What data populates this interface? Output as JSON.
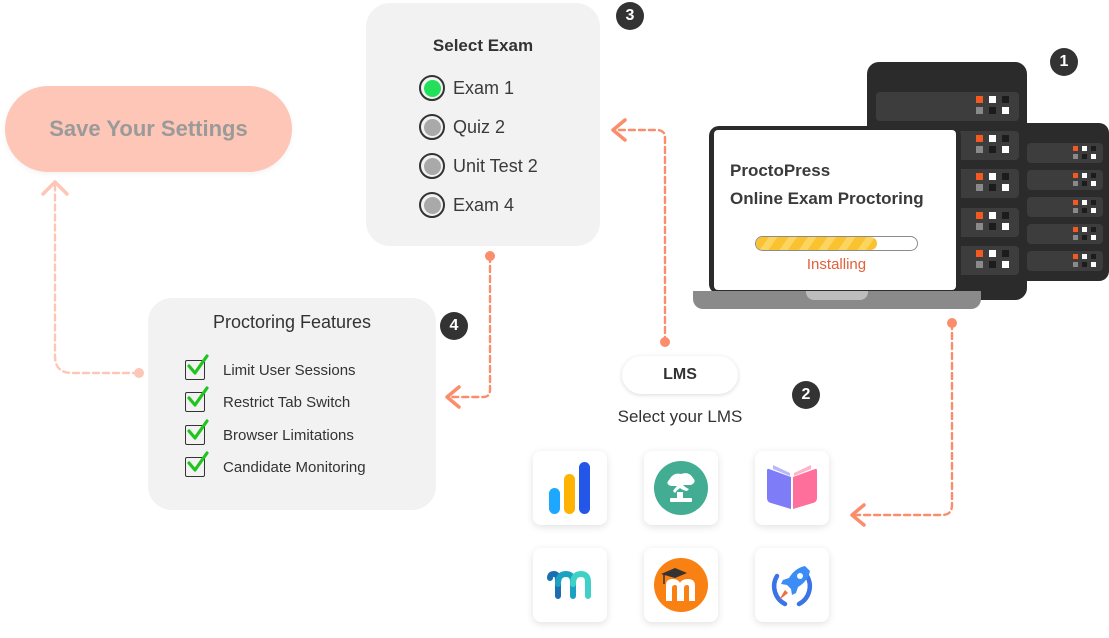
{
  "save_button": {
    "label": "Save Your Settings"
  },
  "steps": {
    "install": {
      "badge": "1"
    },
    "lms": {
      "badge": "2"
    },
    "exam": {
      "badge": "3"
    },
    "features": {
      "badge": "4"
    }
  },
  "select_exam": {
    "title": "Select Exam",
    "options": [
      {
        "label": "Exam 1",
        "selected": true
      },
      {
        "label": "Quiz 2",
        "selected": false
      },
      {
        "label": "Unit Test 2",
        "selected": false
      },
      {
        "label": "Exam 4",
        "selected": false
      }
    ]
  },
  "proctoring_features": {
    "title": "Proctoring Features",
    "items": [
      {
        "label": "Limit User Sessions",
        "checked": true
      },
      {
        "label": "Restrict Tab Switch",
        "checked": true
      },
      {
        "label": "Browser Limitations",
        "checked": true
      },
      {
        "label": "Candidate Monitoring",
        "checked": true
      }
    ]
  },
  "laptop": {
    "app_name": "ProctoPress",
    "app_subtitle": "Online Exam Proctoring",
    "progress_percent": 75,
    "status": "Installing"
  },
  "lms": {
    "pill_label": "LMS",
    "prompt": "Select your LMS",
    "options": [
      {
        "icon": "bar-chart-lms-icon"
      },
      {
        "icon": "bonsai-tree-lms-icon"
      },
      {
        "icon": "open-book-lms-icon"
      },
      {
        "icon": "m-letter-lms-icon"
      },
      {
        "icon": "moodle-icon"
      },
      {
        "icon": "rocket-lms-icon"
      }
    ]
  },
  "colors": {
    "accent": "#fa8d6c",
    "save_button_bg": "#fdc6b6",
    "card_bg": "#f2f2f2",
    "selected_radio": "#22e05a",
    "check_green": "#1fc41f",
    "installing_text": "#e2603a",
    "progress_fill": "#f9c22e",
    "badge_bg": "#333333",
    "rack_dark": "#2b2b2b"
  }
}
